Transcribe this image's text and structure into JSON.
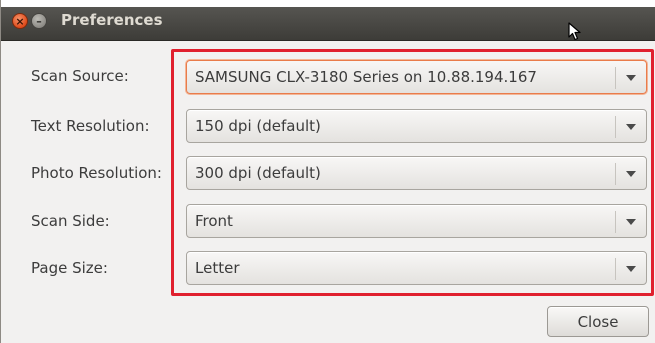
{
  "window": {
    "title": "Preferences"
  },
  "titlebar_buttons": {
    "close_glyph": "×",
    "minimize_glyph": "–"
  },
  "rows": [
    {
      "label": "Scan Source:",
      "value": "SAMSUNG CLX-3180 Series on 10.88.194.167"
    },
    {
      "label": "Text Resolution:",
      "value": "150 dpi (default)"
    },
    {
      "label": "Photo Resolution:",
      "value": "300 dpi (default)"
    },
    {
      "label": "Scan Side:",
      "value": "Front"
    },
    {
      "label": "Page Size:",
      "value": "Letter"
    }
  ],
  "footer": {
    "close_label": "Close"
  },
  "colors": {
    "highlight": "#e0202e",
    "focus": "#e97c4b",
    "titlebar": "#3d3c38"
  },
  "icons": {
    "close": "close-icon",
    "minimize": "minimize-icon",
    "dropdown": "chevron-down-icon",
    "pointer": "mouse-pointer-icon"
  }
}
